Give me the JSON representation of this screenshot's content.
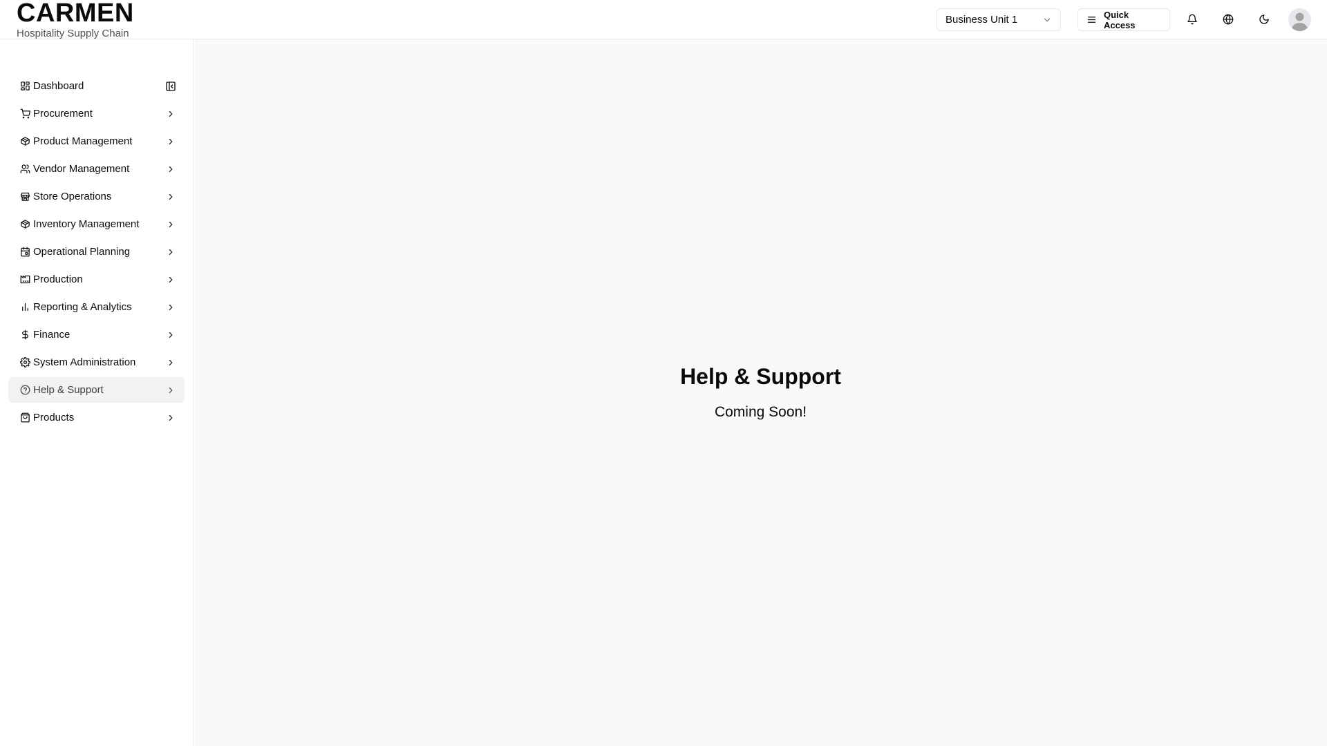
{
  "brand": {
    "title": "CARMEN",
    "subtitle": "Hospitality Supply Chain"
  },
  "header": {
    "business_unit": "Business Unit 1",
    "quick_access_label": "Quick Access",
    "icons": [
      "bell-icon",
      "globe-icon",
      "moon-icon",
      "avatar"
    ]
  },
  "sidebar": {
    "items": [
      {
        "label": "Dashboard",
        "icon": "dashboard-icon",
        "trailing": "collapse-sidebar-icon"
      },
      {
        "label": "Procurement",
        "icon": "cart-icon",
        "trailing": "chevron-right-icon"
      },
      {
        "label": "Product Management",
        "icon": "package-icon",
        "trailing": "chevron-right-icon"
      },
      {
        "label": "Vendor Management",
        "icon": "users-icon",
        "trailing": "chevron-right-icon"
      },
      {
        "label": "Store Operations",
        "icon": "store-icon",
        "trailing": "chevron-right-icon"
      },
      {
        "label": "Inventory Management",
        "icon": "package-icon",
        "trailing": "chevron-right-icon"
      },
      {
        "label": "Operational Planning",
        "icon": "calendar-icon",
        "trailing": "chevron-right-icon"
      },
      {
        "label": "Production",
        "icon": "factory-icon",
        "trailing": "chevron-right-icon"
      },
      {
        "label": "Reporting & Analytics",
        "icon": "bar-chart-icon",
        "trailing": "chevron-right-icon"
      },
      {
        "label": "Finance",
        "icon": "dollar-icon",
        "trailing": "chevron-right-icon"
      },
      {
        "label": "System Administration",
        "icon": "gear-icon",
        "trailing": "chevron-right-icon"
      },
      {
        "label": "Help & Support",
        "icon": "help-circle-icon",
        "trailing": "chevron-right-icon",
        "active": true
      },
      {
        "label": "Products",
        "icon": "shopping-bag-icon",
        "trailing": "chevron-right-icon"
      }
    ]
  },
  "main": {
    "title": "Help & Support",
    "subtitle": "Coming Soon!"
  },
  "colors": {
    "active_item_bg": "#f1f2f4",
    "main_bg": "#f8f9fb",
    "border": "#e5e7eb"
  }
}
